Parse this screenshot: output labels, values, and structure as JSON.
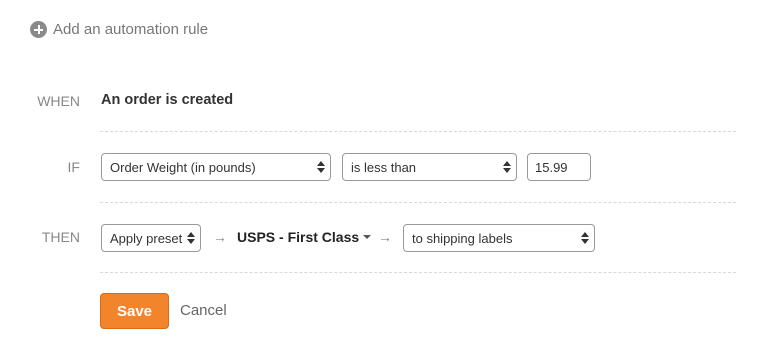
{
  "add_rule": {
    "label": "Add an automation rule",
    "icon": "plus-circle-icon"
  },
  "when": {
    "label": "WHEN",
    "trigger": "An order is created"
  },
  "if": {
    "label": "IF",
    "field_select": "Order Weight (in pounds)",
    "operator_select": "is less than",
    "value_input": "15.99"
  },
  "then": {
    "label": "THEN",
    "action_select": "Apply preset",
    "arrow": "→",
    "preset": "USPS - First Class",
    "target_select": "to shipping labels"
  },
  "actions": {
    "save_label": "Save",
    "cancel_label": "Cancel"
  },
  "colors": {
    "accent": "#f2842c",
    "label_gray": "#888888",
    "text": "#333333"
  }
}
